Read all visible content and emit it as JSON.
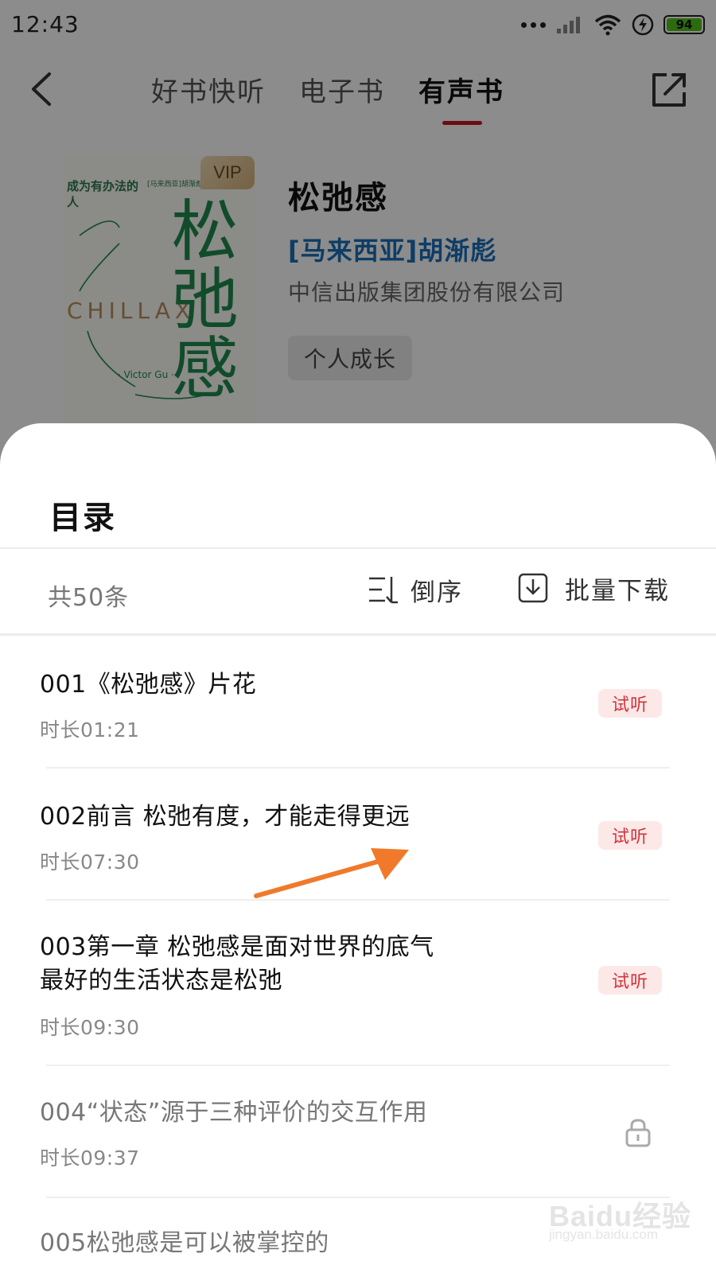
{
  "statusbar": {
    "time": "12:43",
    "battery": "94"
  },
  "navbar": {
    "tabs": [
      {
        "label": "好书快听",
        "active": false
      },
      {
        "label": "电子书",
        "active": false
      },
      {
        "label": "有声书",
        "active": true
      }
    ]
  },
  "book": {
    "title": "松弛感",
    "author": "[马来西亚]胡渐彪",
    "publisher": "中信出版集团股份有限公司",
    "tag": "个人成长",
    "cover": {
      "subtitle": "成为有办法的人",
      "author_small": "[马来西亚]胡渐彪 · 著",
      "big_title": "松弛感",
      "english": "CHILLAX",
      "victor": "· Victor Gu ·",
      "badge": "VIP"
    }
  },
  "sheet": {
    "title": "目录",
    "count": "共50条",
    "sort_label": "倒序",
    "download_label": "批量下载"
  },
  "chapters": [
    {
      "title": "001《松弛感》片花",
      "duration": "时长01:21",
      "badge": "试听",
      "locked": false
    },
    {
      "title": "002前言 松弛有度，才能走得更远",
      "duration": "时长07:30",
      "badge": "试听",
      "locked": false
    },
    {
      "title": "003第一章 松弛感是面对世界的底气 最好的生活状态是松弛",
      "duration": "时长09:30",
      "badge": "试听",
      "locked": false
    },
    {
      "title": "004“状态”源于三种评价的交互作用",
      "duration": "时长09:37",
      "badge": "",
      "locked": true
    },
    {
      "title": "005松弛感是可以被掌控的",
      "duration": "",
      "badge": "",
      "locked": true
    }
  ],
  "watermark": {
    "text": "Baidu经验",
    "url": "jingyan.baidu.com"
  },
  "colors": {
    "accent": "#c4191f",
    "author_link": "#1b6fb8",
    "trial_bg": "#fde8e8",
    "trial_text": "#d0343a",
    "annotation_arrow": "#f07a2a"
  }
}
